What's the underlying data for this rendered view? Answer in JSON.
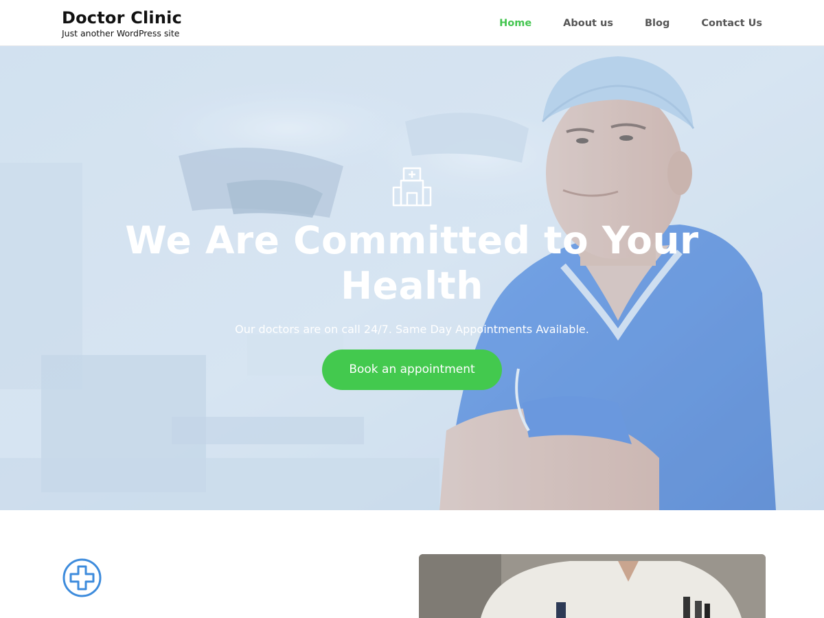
{
  "header": {
    "site_title": "Doctor Clinic",
    "site_tagline": "Just another WordPress site",
    "nav": [
      {
        "label": "Home",
        "active": true
      },
      {
        "label": "About us",
        "active": false
      },
      {
        "label": "Blog",
        "active": false
      },
      {
        "label": "Contact Us",
        "active": false
      }
    ]
  },
  "hero": {
    "icon": "hospital-building-icon",
    "title": "We Are Committed to Your Health",
    "subtitle": "Our doctors are on call 24/7. Same Day Appointments Available.",
    "button_label": "Book an appointment"
  },
  "section": {
    "icon": "medical-plus-icon"
  },
  "colors": {
    "accent_green": "#43c94e",
    "nav_active": "#43c54f",
    "icon_blue": "#3d8bdc",
    "scrubs_blue": "#2f6fd0"
  }
}
